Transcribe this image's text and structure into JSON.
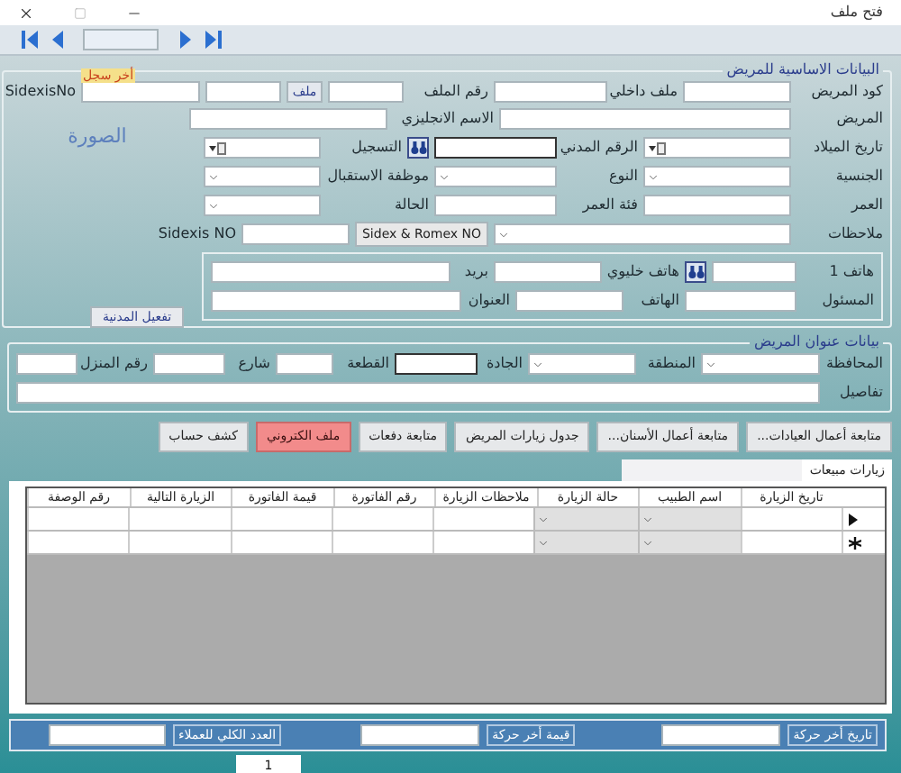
{
  "window": {
    "title": "فتح ملف"
  },
  "basic_info": {
    "title": "البيانات الاساسية للمريض",
    "patient_code": "كود المريض",
    "internal_file": "ملف داخلي",
    "file_number": "رقم الملف",
    "file_button": "ملف",
    "last_record_tag": "أخر سجل",
    "sidexis_label": "SidexisNo",
    "patient": "المريض",
    "english_name": "الاسم الانجليزي",
    "photo": "الصورة",
    "birth_date": "تاريخ الميلاد",
    "civil_id": "الرقم المدني",
    "registration": "التسجيل",
    "nationality": "الجنسية",
    "gender": "النوع",
    "receptionist": "موظفة الاستقبال",
    "age": "العمر",
    "age_group": "فئة العمر",
    "status": "الحالة",
    "notes": "ملاحظات",
    "sidex_button": "Sidex & Romex NO",
    "sidexis_no": "Sidexis NO"
  },
  "contact": {
    "phone1": "هاتف 1",
    "mobile": "هاتف خليوي",
    "email": "بريد",
    "responsible": "المسئول",
    "phone": "الهاتف",
    "address": "العنوان"
  },
  "activate_civil_button": "تفعيل المدنية",
  "address": {
    "title": "بيانات عنوان المريض",
    "governorate": "المحافظة",
    "area": "المنطقة",
    "avenue": "الجادة",
    "block": "القطعة",
    "street": "شارع",
    "house_number": "رقم المنزل",
    "details": "تفاصيل"
  },
  "action_buttons": [
    {
      "label": "متابعة أعمال العيادات...",
      "kind": "normal"
    },
    {
      "label": "متابعة أعمال الأسنان...",
      "kind": "normal"
    },
    {
      "label": "جدول زيارات المريض",
      "kind": "normal"
    },
    {
      "label": "متابعة دفعات",
      "kind": "normal"
    },
    {
      "label": "ملف الكتروني",
      "kind": "alert"
    },
    {
      "label": "كشف حساب",
      "kind": "normal"
    }
  ],
  "tabs": [
    {
      "label": "زيارات مبيعات",
      "selected": true
    }
  ],
  "table": {
    "columns": [
      {
        "label": "تاريخ الزيارة",
        "kind": "text"
      },
      {
        "label": "اسم الطبيب",
        "kind": "combo"
      },
      {
        "label": "حالة الزيارة",
        "kind": "combo"
      },
      {
        "label": "ملاحظات الزيارة",
        "kind": "text"
      },
      {
        "label": "رقم الفاتورة",
        "kind": "text"
      },
      {
        "label": "قيمة الفاتورة",
        "kind": "text"
      },
      {
        "label": "الزيارة التالية",
        "kind": "text"
      },
      {
        "label": "رقم الوصفة",
        "kind": "text"
      }
    ],
    "rows": [
      {
        "kind": "current"
      },
      {
        "kind": "new"
      }
    ]
  },
  "status_bar": {
    "last_move_date": "تاريخ أخر حركة",
    "last_move_value": "قيمة أخر حركة",
    "total_clients": "العدد الكلي للعملاء"
  },
  "page_tabs": [
    {
      "label": "1",
      "selected": true
    }
  ]
}
